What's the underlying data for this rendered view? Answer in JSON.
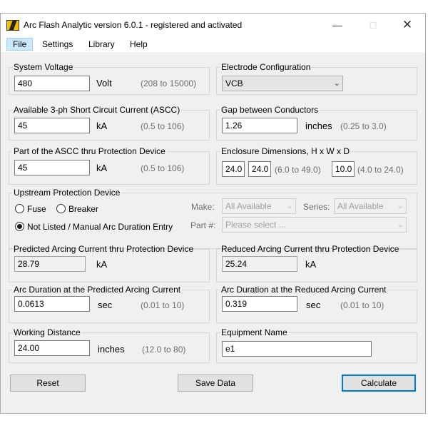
{
  "window": {
    "title": "Arc Flash Analytic version 6.0.1 - registered and activated"
  },
  "menu": {
    "file": "File",
    "settings": "Settings",
    "library": "Library",
    "help": "Help"
  },
  "system_voltage": {
    "legend": "System Voltage",
    "value": "480",
    "unit": "Volt",
    "range": "(208 to 15000)"
  },
  "electrode": {
    "legend": "Electrode Configuration",
    "selected": "VCB"
  },
  "ascc": {
    "legend": "Available 3-ph Short Circuit Current (ASCC)",
    "value": "45",
    "unit": "kA",
    "range": "(0.5 to 106)"
  },
  "gap": {
    "legend": "Gap between Conductors",
    "value": "1.26",
    "unit": "inches",
    "range": "(0.25 to 3.0)"
  },
  "ascc_thru": {
    "legend": "Part of the ASCC thru Protection Device",
    "value": "45",
    "unit": "kA",
    "range": "(0.5 to 106)"
  },
  "enclosure": {
    "legend": "Enclosure Dimensions, H x W x D",
    "h": "24.0",
    "w": "24.0",
    "hw_range": "(6.0 to 49.0)",
    "d": "10.0",
    "d_range": "(4.0 to 24.0)"
  },
  "upstream": {
    "legend": "Upstream Protection Device",
    "fuse": "Fuse",
    "breaker": "Breaker",
    "not_listed": "Not Listed / Manual Arc Duration Entry",
    "make_label": "Make:",
    "make_value": "All Available",
    "series_label": "Series:",
    "series_value": "All Available",
    "part_label": "Part #:",
    "part_placeholder": "Please select ..."
  },
  "predicted_arcing": {
    "legend": "Predicted Arcing Current thru Protection Device",
    "value": "28.79",
    "unit": "kA"
  },
  "reduced_arcing": {
    "legend": "Reduced Arcing Current thru Protection Device",
    "value": "25.24",
    "unit": "kA"
  },
  "arc_duration_pred": {
    "legend": "Arc Duration at the Predicted Arcing Current",
    "value": "0.0613",
    "unit": "sec",
    "range": "(0.01 to 10)"
  },
  "arc_duration_red": {
    "legend": "Arc Duration at the Reduced Arcing Current",
    "value": "0.319",
    "unit": "sec",
    "range": "(0.01 to 10)"
  },
  "working_distance": {
    "legend": "Working Distance",
    "value": "24.00",
    "unit": "inches",
    "range": "(12.0 to 80)"
  },
  "equipment": {
    "legend": "Equipment Name",
    "value": "e1"
  },
  "buttons": {
    "reset": "Reset",
    "save": "Save Data",
    "calculate": "Calculate"
  }
}
